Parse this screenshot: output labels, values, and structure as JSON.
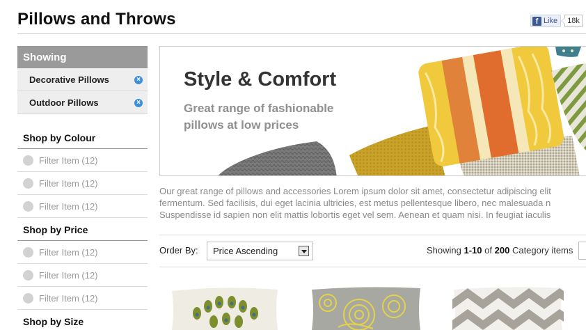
{
  "header": {
    "title": "Pillows and Throws",
    "fb_icon": "f",
    "fb_label": "Like",
    "fb_count": "18k"
  },
  "sidebar": {
    "showing_title": "Showing",
    "active_filters": [
      {
        "label": "Decorative Pillows"
      },
      {
        "label": "Outdoor Pillows"
      }
    ],
    "remove_icon_glyph": "×",
    "sections": [
      {
        "title": "Shop by Colour",
        "items": [
          "Filter Item (12)",
          "Filter Item (12)",
          "Filter Item (12)"
        ]
      },
      {
        "title": "Shop by Price",
        "items": [
          "Filter Item (12)",
          "Filter Item (12)",
          "Filter Item (12)"
        ]
      },
      {
        "title": "Shop by Size",
        "items": []
      }
    ]
  },
  "banner": {
    "title": "Style & Comfort",
    "subtitle": "Great range of fashionable pillows at low prices"
  },
  "intro": {
    "lines": [
      "Our great range of pillows and accessories Lorem ipsum dolor sit amet, consectetur adipiscing elit",
      "fermentum. Sed facilisis, dui eget lacinia ultricies, est metus pellentesque libero, nec malesuada n",
      "Suspendisse id sapien non elit mattis lobortis eget vel sem. Aenean et quam nisi. In feugiat iaculis"
    ]
  },
  "toolbar": {
    "order_label": "Order By:",
    "order_value": "Price Ascending",
    "showing_prefix": "Showing",
    "showing_range": "1-10",
    "showing_of": "of",
    "showing_total": "200",
    "showing_suffix": "Category items"
  },
  "products": [
    {
      "name": "peacock-feather-pillow"
    },
    {
      "name": "yellow-floral-pillow"
    },
    {
      "name": "grey-chevron-pillow"
    }
  ],
  "colors": {
    "accent_blue": "#3d8fd6",
    "showing_header": "#9a9a9a",
    "facebook": "#3b5998"
  }
}
